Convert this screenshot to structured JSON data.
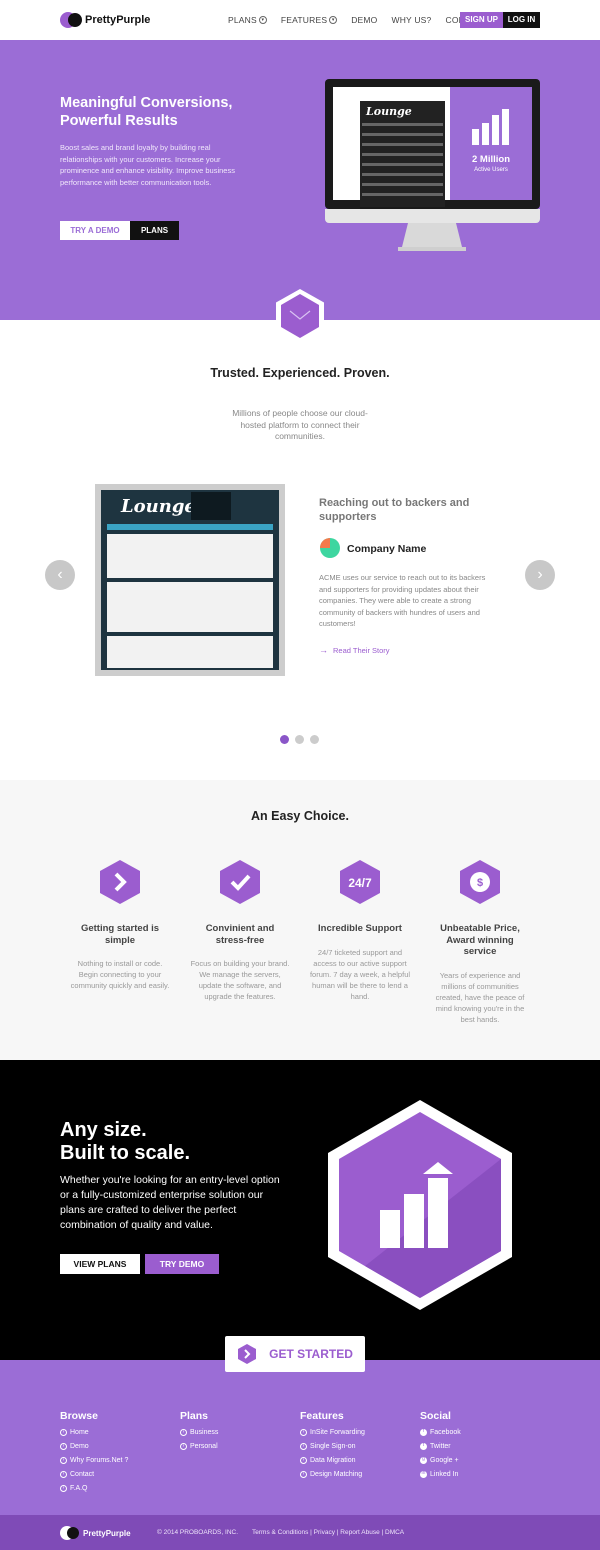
{
  "brand": {
    "name_a": "Pretty",
    "name_b": "Purple"
  },
  "nav": {
    "items": [
      {
        "label": "PLANS",
        "chevron": true
      },
      {
        "label": "FEATURES",
        "chevron": true
      },
      {
        "label": "DEMO",
        "chevron": false
      },
      {
        "label": "WHY US?",
        "chevron": false
      },
      {
        "label": "CONTACT",
        "chevron": false
      }
    ],
    "signup": "SIGN UP",
    "login": "LOG IN"
  },
  "hero": {
    "title": "Meaningful Conversions, Powerful Results",
    "text": "Boost sales and brand loyalty by building real relationships with your customers. Increase your prominence and enhance visibility. Improve business performance with better communication tools.",
    "try_demo": "TRY A DEMO",
    "plans": "PLANS",
    "screen_logo": "Lounge",
    "stat_value": "2 Million",
    "stat_label": "Active Users"
  },
  "trust": {
    "title": "Trusted. Experienced. Proven.",
    "text": "Millions of people choose our cloud-hosted platform to connect their communities."
  },
  "story": {
    "screenshot_logo": "Lounge",
    "heading": "Reaching out to backers and supporters",
    "company": "Company Name",
    "text": "ACME uses our service to reach out to its backers and supporters for providing updates about their companies.  They were able to create a strong community of backers with hundres of users and customers!",
    "read_more": "Read Their Story",
    "prev": "‹",
    "next": "›",
    "active_dot": 0
  },
  "easy": {
    "title": "An Easy Choice.",
    "features": [
      {
        "icon": "arrow-icon",
        "title": "Getting started is simple",
        "text": "Nothing to install or code. Begin connecting to your community quickly and easily."
      },
      {
        "icon": "checkmark-icon",
        "title": "Convinient and stress-free",
        "text": "Focus on building your brand. We manage the servers, update the software, and upgrade the features."
      },
      {
        "icon": "24-7-icon",
        "title": "Incredible Support",
        "text": "24/7 ticketed support and access to our active support forum. 7 day a week, a helpful human will be there to lend a hand."
      },
      {
        "icon": "dollar-badge-icon",
        "title": "Unbeatable Price, Award winning service",
        "text": "Years of experience and millions of communities created, have the peace of mind knowing you're in the best hands."
      }
    ]
  },
  "scale": {
    "title_1": "Any size.",
    "title_2": "Built to scale.",
    "text": "Whether you're looking for an entry-level option or a fully-customized enterprise solution our plans are crafted to deliver the perfect combination of quality and value.",
    "view_plans": "VIEW PLANS",
    "try_demo": "TRY DEMO"
  },
  "cta": {
    "label": "GET STARTED"
  },
  "footer": {
    "columns": [
      {
        "title": "Browse",
        "links": [
          "Home",
          "Demo",
          "Why Forums.Net ?",
          "Contact",
          "F.A.Q"
        ]
      },
      {
        "title": "Plans",
        "links": [
          "Business",
          "Personal"
        ]
      },
      {
        "title": "Features",
        "links": [
          "InSite Forwarding",
          "Single Sign-on",
          "Data Migration",
          "Design Matching"
        ]
      },
      {
        "title": "Social",
        "links": [
          "Facebook",
          "Twitter",
          "Google +",
          "Linked In"
        ]
      }
    ],
    "copyright": "© 2014 PROBOARDS, INC.",
    "links": [
      "Terms & Conditions",
      "Privacy",
      "Report Abuse",
      "DMCA"
    ]
  },
  "colors": {
    "accent": "#9b6dd6",
    "accent_dark": "#7f4bb7",
    "black": "#000000"
  }
}
